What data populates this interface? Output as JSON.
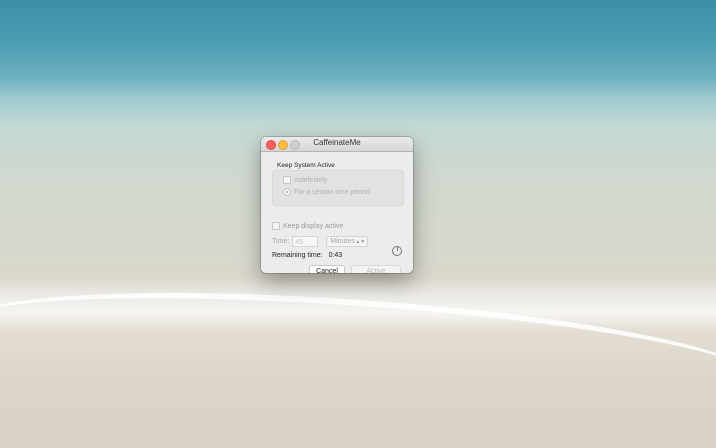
{
  "window": {
    "title": "CaffeinateMe"
  },
  "keep_system": {
    "title": "Keep System Active",
    "option_indefinitely": "Indefinitely",
    "option_period": "For a certain time period"
  },
  "display": {
    "label": "Keep display active"
  },
  "time": {
    "label": "Time:",
    "value": "45",
    "unit": "Minutes"
  },
  "remaining": {
    "label": "Remaining time:",
    "value": "0:43"
  },
  "buttons": {
    "cancel": "Cancel",
    "active": "Active"
  }
}
